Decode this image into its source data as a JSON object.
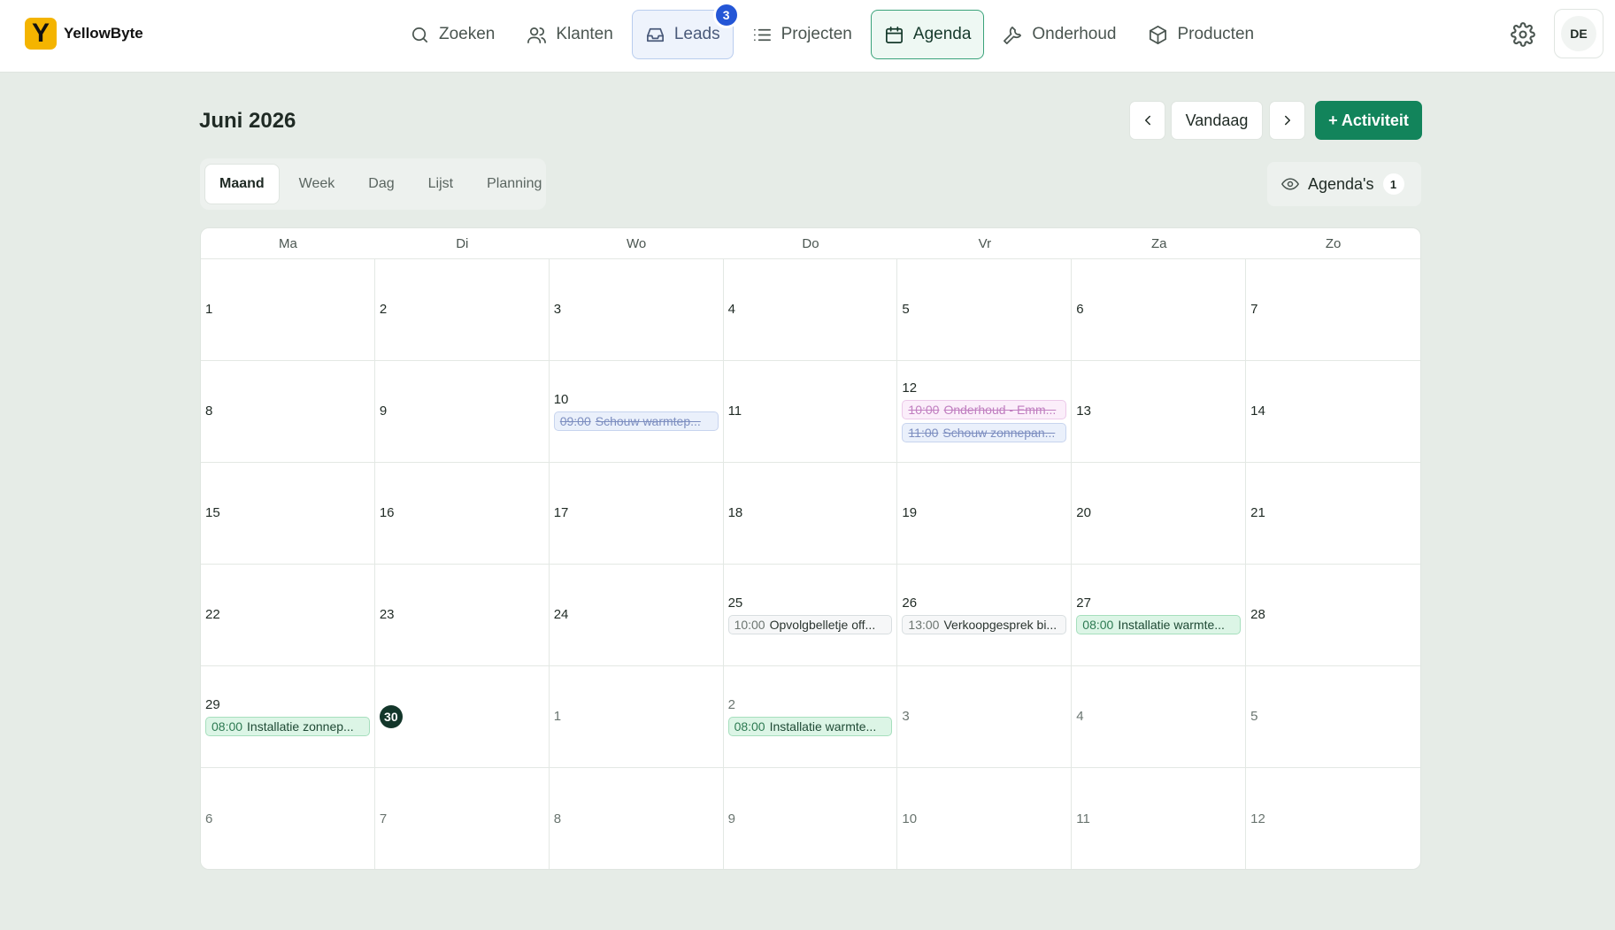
{
  "app": {
    "name": "YellowByte",
    "logo_letter": "Y",
    "brand_color": "#f4b400",
    "accent": "#12845b"
  },
  "nav": [
    {
      "label": "Zoeken",
      "icon": "search-icon"
    },
    {
      "label": "Klanten",
      "icon": "users-icon"
    },
    {
      "label": "Leads",
      "icon": "inbox-icon",
      "badge": "3"
    },
    {
      "label": "Projecten",
      "icon": "list-icon"
    },
    {
      "label": "Agenda",
      "icon": "calendar-icon",
      "active": true
    },
    {
      "label": "Onderhoud",
      "icon": "wrench-icon"
    },
    {
      "label": "Producten",
      "icon": "box-icon"
    }
  ],
  "user": {
    "initials": "DE"
  },
  "header": {
    "title": "Juni 2026",
    "today_label": "Vandaag",
    "add_label": "+ Activiteit"
  },
  "views": [
    "Maand",
    "Week",
    "Dag",
    "Lijst",
    "Planning"
  ],
  "active_view": "Maand",
  "agendas": {
    "label": "Agenda's",
    "count": "1"
  },
  "weekdays": [
    "Ma",
    "Di",
    "Wo",
    "Do",
    "Vr",
    "Za",
    "Zo"
  ],
  "weeks": [
    [
      {
        "day": "1"
      },
      {
        "day": "2"
      },
      {
        "day": "3"
      },
      {
        "day": "4"
      },
      {
        "day": "5"
      },
      {
        "day": "6"
      },
      {
        "day": "7"
      }
    ],
    [
      {
        "day": "8"
      },
      {
        "day": "9"
      },
      {
        "day": "10",
        "events": [
          {
            "time": "09:00",
            "title": "Schouw warmtep...",
            "style": "blue"
          }
        ]
      },
      {
        "day": "11"
      },
      {
        "day": "12",
        "events": [
          {
            "time": "10:00",
            "title": "Onderhoud - Emm...",
            "style": "pink"
          },
          {
            "time": "11:00",
            "title": "Schouw zonnepan...",
            "style": "blue"
          }
        ]
      },
      {
        "day": "13"
      },
      {
        "day": "14"
      }
    ],
    [
      {
        "day": "15"
      },
      {
        "day": "16"
      },
      {
        "day": "17"
      },
      {
        "day": "18"
      },
      {
        "day": "19"
      },
      {
        "day": "20"
      },
      {
        "day": "21"
      }
    ],
    [
      {
        "day": "22"
      },
      {
        "day": "23"
      },
      {
        "day": "24"
      },
      {
        "day": "25",
        "events": [
          {
            "time": "10:00",
            "title": "Opvolgbelletje off...",
            "style": "gray"
          }
        ]
      },
      {
        "day": "26",
        "events": [
          {
            "time": "13:00",
            "title": "Verkoopgesprek bi...",
            "style": "gray"
          }
        ]
      },
      {
        "day": "27",
        "events": [
          {
            "time": "08:00",
            "title": "Installatie warmte...",
            "style": "green"
          }
        ]
      },
      {
        "day": "28"
      }
    ],
    [
      {
        "day": "29",
        "events": [
          {
            "time": "08:00",
            "title": "Installatie zonnep...",
            "style": "green"
          }
        ]
      },
      {
        "day": "30",
        "today": true
      },
      {
        "day": "1",
        "other": true
      },
      {
        "day": "2",
        "other": true,
        "events": [
          {
            "time": "08:00",
            "title": "Installatie warmte...",
            "style": "green"
          }
        ]
      },
      {
        "day": "3",
        "other": true
      },
      {
        "day": "4",
        "other": true
      },
      {
        "day": "5",
        "other": true
      }
    ],
    [
      {
        "day": "6",
        "other": true
      },
      {
        "day": "7",
        "other": true
      },
      {
        "day": "8",
        "other": true
      },
      {
        "day": "9",
        "other": true
      },
      {
        "day": "10",
        "other": true
      },
      {
        "day": "11",
        "other": true
      },
      {
        "day": "12",
        "other": true
      }
    ]
  ]
}
